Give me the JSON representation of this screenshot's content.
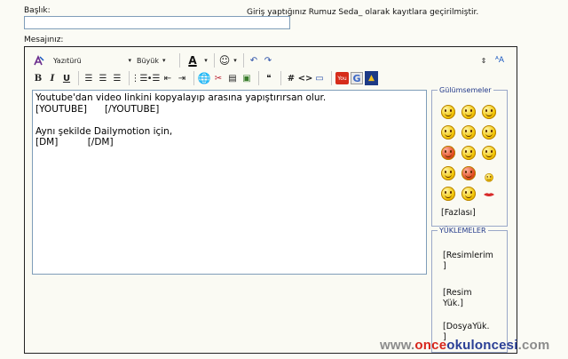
{
  "form": {
    "subject_label": "Başlık:",
    "subject_value": "",
    "login_notice": "Giriş yaptığınız Rumuz Seda_ olarak kayıtlara geçirilmiştir.",
    "message_label": "Mesajınız:"
  },
  "toolbar": {
    "font_select": "Yazıtürü",
    "size_select": "Büyük",
    "bold": "B",
    "italic": "I",
    "underline": "U",
    "code_tag": "#",
    "html_tag": "<>"
  },
  "editor": {
    "content": "Youtube'dan video linkini kopyalayıp arasına yapıştırırsan olur.\n[YOUTUBE]      [/YOUTUBE]\n\nAynı şekilde Dailymotion için,\n[DM]          [/DM]"
  },
  "smileys_panel": {
    "title": "Gülümsemeler",
    "more_label": "[Fazlası]",
    "count": 15
  },
  "uploads_panel": {
    "title": "YÜKLEMELER",
    "items": [
      "[Resimlerim\n]",
      "[Resim\nYük.]",
      "[DosyaYük.\n]"
    ]
  },
  "watermark": {
    "prefix": "www.",
    "brand_red": "once",
    "brand_blue": "okuloncesi",
    "suffix": ".com",
    "colors": {
      "gray": "#8c8c8c",
      "red": "#d8261c",
      "blue": "#2a3f96"
    }
  }
}
